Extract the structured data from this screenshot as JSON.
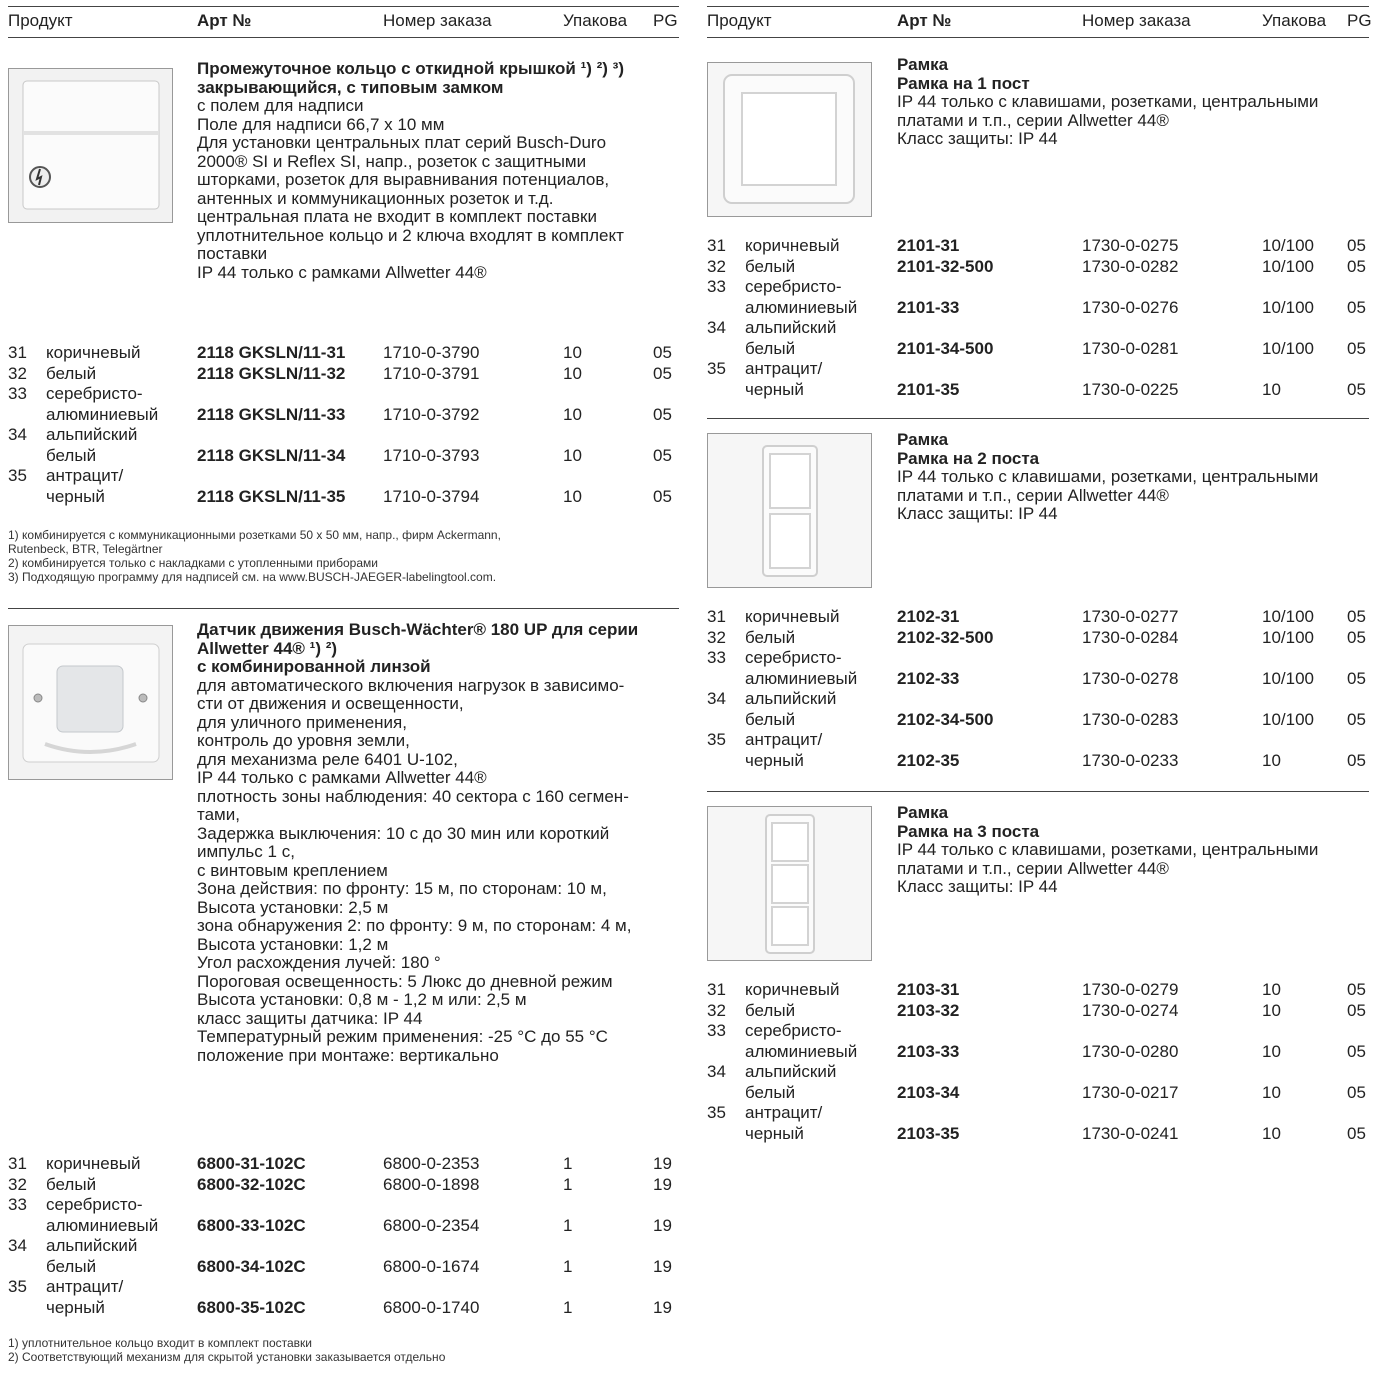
{
  "header": {
    "product": "Продукт",
    "art": "Арт №",
    "order": "Номер заказа",
    "pack": "Упакова",
    "pg": "PG"
  },
  "left": {
    "s1": {
      "title_lines": [
        "Промежуточное кольцо с откидной крышкой ¹) ²) ³)",
        "закрывающийся, с типовым замком"
      ],
      "lines": [
        "с полем для надписи",
        "Поле для надписи 66,7 x 10 мм",
        "Для установки центральных плат серий Busch-Duro",
        "2000® SI и Reflex SI, напр., розеток с защитными",
        "шторками, розеток для выравнивания потенциалов,",
        "антенных и коммуникационных розеток и т.д.",
        "центральная плата не входит в комплект поставки",
        "уплотнительное кольцо и 2 ключа входлят в комплект",
        "поставки",
        "IP 44 только с рамками Allwetter 44®"
      ],
      "rows": [
        {
          "num": "31",
          "color": "коричневый",
          "color2": "",
          "art": "2118 GKSLN/11-31",
          "order": "1710-0-3790",
          "pack": "10",
          "pg": "05"
        },
        {
          "num": "32",
          "color": "белый",
          "color2": "",
          "art": "2118 GKSLN/11-32",
          "order": "1710-0-3791",
          "pack": "10",
          "pg": "05"
        },
        {
          "num": "33",
          "color": "серебристо-",
          "color2": "алюминиевый",
          "art": "2118 GKSLN/11-33",
          "order": "1710-0-3792",
          "pack": "10",
          "pg": "05"
        },
        {
          "num": "34",
          "color": "альпийский",
          "color2": "белый",
          "art": "2118 GKSLN/11-34",
          "order": "1710-0-3793",
          "pack": "10",
          "pg": "05"
        },
        {
          "num": "35",
          "color": "антрацит/",
          "color2": "черный",
          "art": "2118 GKSLN/11-35",
          "order": "1710-0-3794",
          "pack": "10",
          "pg": "05"
        }
      ],
      "footnotes": [
        "1)  комбинируется с коммуникационными розетками  50 x 50 мм, напр., фирм Ackermann,",
        "     Rutenbeck, BTR, Telegärtner",
        "2)  комбинируется только с накладками с утопленными приборами",
        "3)  Подходящую программу для надписей см. на www.BUSCH-JAEGER-labelingtool.com."
      ]
    },
    "s2": {
      "title_lines": [
        "Датчик движения Busch-Wächter® 180 UP для серии",
        "Allwetter 44® ¹) ²)",
        "с комбинированной линзой"
      ],
      "lines": [
        "для автоматического включения нагрузок в зависимо-",
        "сти от движения и освещенности,",
        "для уличного применения,",
        "контроль до уровня земли,",
        "для механизма реле 6401 U-102,",
        "IP 44 только с рамками Allwetter 44®",
        "плотность зоны наблюдения: 40 сектора с 160 сегмен-",
        "тами,",
        "Задержка выключения: 10 с до 30 мин или короткий",
        "импульс 1 с,",
        "с винтовым креплением",
        "Зона действия: по фронту: 15 м, по сторонам: 10 м,",
        "Высота установки: 2,5 м",
        "зона обнаружения 2: по фронту: 9 м, по сторонам: 4 м,",
        "Высота установки: 1,2 м",
        "Угол расхождения лучей: 180 °",
        "Пороговая освещенность: 5 Люкс до дневной режим",
        "Высота установки: 0,8 м - 1,2 м или: 2,5 м",
        "класс защиты датчика: IP 44",
        "Температурный режим применения: -25 °C до 55 °C",
        "положение при монтаже: вертикально"
      ],
      "rows": [
        {
          "num": "31",
          "color": "коричневый",
          "color2": "",
          "art": "6800-31-102C",
          "order": "6800-0-2353",
          "pack": "1",
          "pg": "19"
        },
        {
          "num": "32",
          "color": "белый",
          "color2": "",
          "art": "6800-32-102C",
          "order": "6800-0-1898",
          "pack": "1",
          "pg": "19"
        },
        {
          "num": "33",
          "color": "серебристо-",
          "color2": "алюминиевый",
          "art": "6800-33-102C",
          "order": "6800-0-2354",
          "pack": "1",
          "pg": "19"
        },
        {
          "num": "34",
          "color": "альпийский",
          "color2": "белый",
          "art": "6800-34-102C",
          "order": "6800-0-1674",
          "pack": "1",
          "pg": "19"
        },
        {
          "num": "35",
          "color": "антрацит/",
          "color2": "черный",
          "art": "6800-35-102C",
          "order": "6800-0-1740",
          "pack": "1",
          "pg": "19"
        }
      ],
      "footnotes": [
        "1)  уплотнительное кольцо входит в комплект поставки",
        "2)  Соответствующий механизм для скрытой установки заказывается отдельно"
      ]
    }
  },
  "right": {
    "s1": {
      "title_lines": [
        "Рамка",
        "Рамка на 1 пост"
      ],
      "lines": [
        "IP 44 только с клавишами, розетками, центральными",
        "платами и т.п., серии Allwetter 44®",
        "Класс защиты: IP 44"
      ],
      "rows": [
        {
          "num": "31",
          "color": "коричневый",
          "color2": "",
          "art": "2101-31",
          "order": "1730-0-0275",
          "pack": "10/100",
          "pg": "05"
        },
        {
          "num": "32",
          "color": "белый",
          "color2": "",
          "art": "2101-32-500",
          "order": "1730-0-0282",
          "pack": "10/100",
          "pg": "05"
        },
        {
          "num": "33",
          "color": "серебристо-",
          "color2": "алюминиевый",
          "art": "2101-33",
          "order": "1730-0-0276",
          "pack": "10/100",
          "pg": "05"
        },
        {
          "num": "34",
          "color": "альпийский",
          "color2": "белый",
          "art": "2101-34-500",
          "order": "1730-0-0281",
          "pack": "10/100",
          "pg": "05"
        },
        {
          "num": "35",
          "color": "антрацит/",
          "color2": "черный",
          "art": "2101-35",
          "order": "1730-0-0225",
          "pack": "10",
          "pg": "05"
        }
      ]
    },
    "s2": {
      "title_lines": [
        "Рамка",
        "Рамка на 2 поста"
      ],
      "lines": [
        "IP 44 только с клавишами, розетками, центральными",
        "платами и т.п., серии Allwetter 44®",
        "Класс защиты: IP 44"
      ],
      "rows": [
        {
          "num": "31",
          "color": "коричневый",
          "color2": "",
          "art": "2102-31",
          "order": "1730-0-0277",
          "pack": "10/100",
          "pg": "05"
        },
        {
          "num": "32",
          "color": "белый",
          "color2": "",
          "art": "2102-32-500",
          "order": "1730-0-0284",
          "pack": "10/100",
          "pg": "05"
        },
        {
          "num": "33",
          "color": "серебристо-",
          "color2": "алюминиевый",
          "art": "2102-33",
          "order": "1730-0-0278",
          "pack": "10/100",
          "pg": "05"
        },
        {
          "num": "34",
          "color": "альпийский",
          "color2": "белый",
          "art": "2102-34-500",
          "order": "1730-0-0283",
          "pack": "10/100",
          "pg": "05"
        },
        {
          "num": "35",
          "color": "антрацит/",
          "color2": "черный",
          "art": "2102-35",
          "order": "1730-0-0233",
          "pack": "10",
          "pg": "05"
        }
      ]
    },
    "s3": {
      "title_lines": [
        "Рамка",
        "Рамка на 3 поста"
      ],
      "lines": [
        "IP 44 только с клавишами, розетками, центральными",
        "платами и т.п., серии Allwetter 44®",
        "Класс защиты: IP 44"
      ],
      "rows": [
        {
          "num": "31",
          "color": "коричневый",
          "color2": "",
          "art": "2103-31",
          "order": "1730-0-0279",
          "pack": "10",
          "pg": "05"
        },
        {
          "num": "32",
          "color": "белый",
          "color2": "",
          "art": "2103-32",
          "order": "1730-0-0274",
          "pack": "10",
          "pg": "05"
        },
        {
          "num": "33",
          "color": "серебристо-",
          "color2": "алюминиевый",
          "art": "2103-33",
          "order": "1730-0-0280",
          "pack": "10",
          "pg": "05"
        },
        {
          "num": "34",
          "color": "альпийский",
          "color2": "белый",
          "art": "2103-34",
          "order": "1730-0-0217",
          "pack": "10",
          "pg": "05"
        },
        {
          "num": "35",
          "color": "антрацит/",
          "color2": "черный",
          "art": "2103-35",
          "order": "1730-0-0241",
          "pack": "10",
          "pg": "05"
        }
      ]
    }
  }
}
